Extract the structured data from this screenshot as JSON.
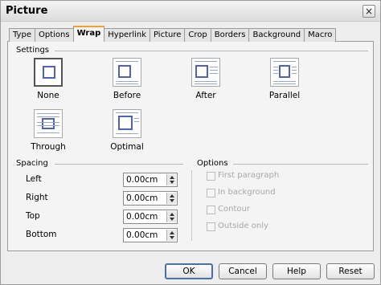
{
  "window": {
    "title": "Picture",
    "close_glyph": "×"
  },
  "tabs": [
    {
      "label": "Type",
      "active": false
    },
    {
      "label": "Options",
      "active": false
    },
    {
      "label": "Wrap",
      "active": true
    },
    {
      "label": "Hyperlink",
      "active": false
    },
    {
      "label": "Picture",
      "active": false
    },
    {
      "label": "Crop",
      "active": false
    },
    {
      "label": "Borders",
      "active": false
    },
    {
      "label": "Background",
      "active": false
    },
    {
      "label": "Macro",
      "active": false
    }
  ],
  "settings": {
    "heading": "Settings",
    "options": [
      {
        "label": "None",
        "icon": "wrap-none-icon",
        "selected": true
      },
      {
        "label": "Before",
        "icon": "wrap-before-icon",
        "selected": false
      },
      {
        "label": "After",
        "icon": "wrap-after-icon",
        "selected": false
      },
      {
        "label": "Parallel",
        "icon": "wrap-parallel-icon",
        "selected": false
      },
      {
        "label": "Through",
        "icon": "wrap-through-icon",
        "selected": false
      },
      {
        "label": "Optimal",
        "icon": "wrap-optimal-icon",
        "selected": false
      }
    ]
  },
  "spacing": {
    "heading": "Spacing",
    "fields": [
      {
        "label": "Left",
        "value": "0.00cm"
      },
      {
        "label": "Right",
        "value": "0.00cm"
      },
      {
        "label": "Top",
        "value": "0.00cm"
      },
      {
        "label": "Bottom",
        "value": "0.00cm"
      }
    ]
  },
  "options": {
    "heading": "Options",
    "checkboxes": [
      {
        "label": "First paragraph",
        "checked": false,
        "enabled": false
      },
      {
        "label": "In background",
        "checked": false,
        "enabled": false
      },
      {
        "label": "Contour",
        "checked": false,
        "enabled": false
      },
      {
        "label": "Outside only",
        "checked": false,
        "enabled": false
      }
    ]
  },
  "buttons": {
    "ok": "OK",
    "cancel": "Cancel",
    "help": "Help",
    "reset": "Reset"
  },
  "colors": {
    "icon_frame": "#4d62b8",
    "icon_text": "#9aa6c8",
    "disabled_text": "#a8a8a8"
  }
}
